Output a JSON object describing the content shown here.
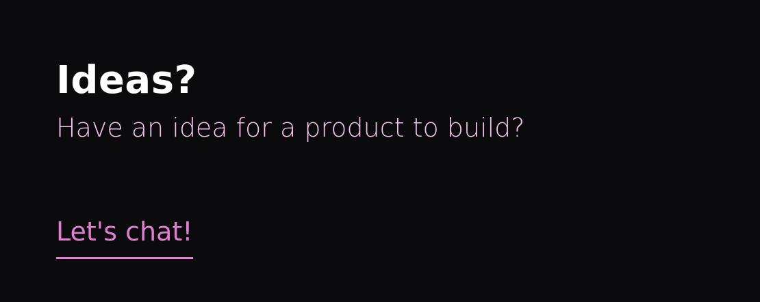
{
  "section": {
    "title": "Ideas?",
    "subtitle": "Have an idea for a product to build?",
    "cta_label": "Let's chat!"
  },
  "colors": {
    "background": "#0b0a0d",
    "title": "#ffffff",
    "subtitle": "#f2c4ea",
    "accent": "#df7fcf"
  }
}
